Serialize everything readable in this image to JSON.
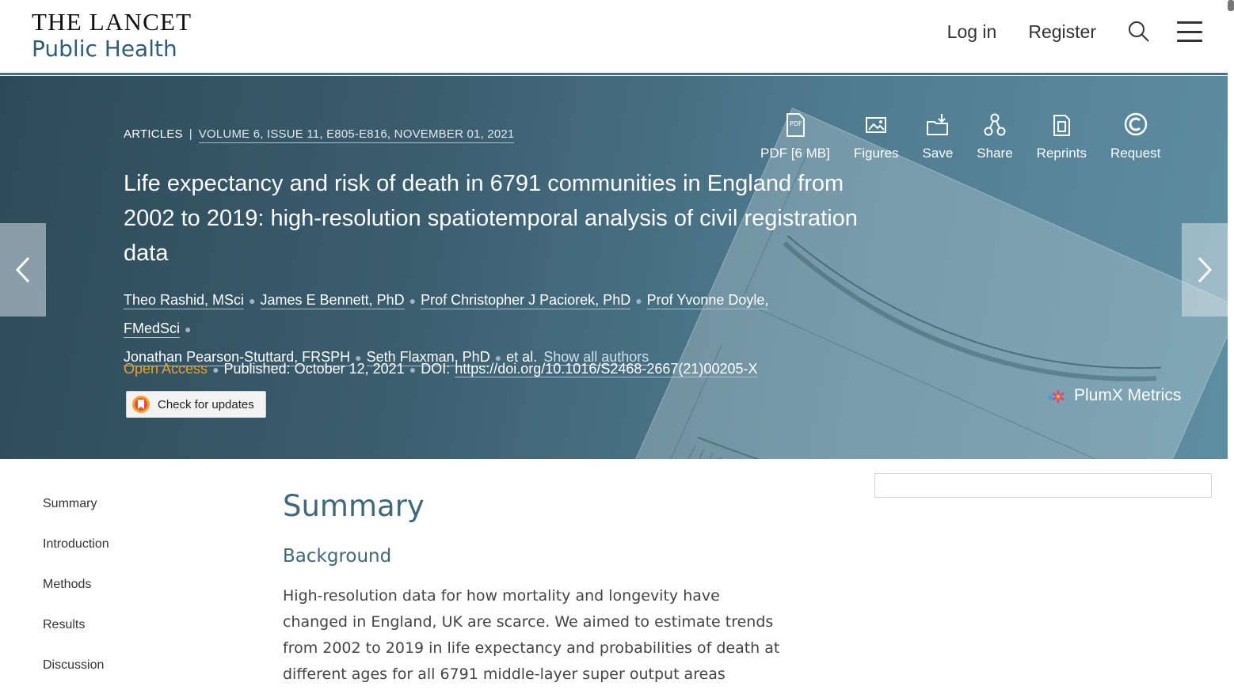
{
  "header": {
    "logo_line1": "THE LANCET",
    "logo_line2": "Public Health",
    "login": "Log in",
    "register": "Register",
    "search_icon": "search-icon",
    "menu_icon": "hamburger-menu-icon"
  },
  "article": {
    "type": "ARTICLES",
    "volume": "VOLUME 6, ISSUE 11, E805-E816, NOVEMBER 01, 2021",
    "title": "Life expectancy and risk of death in 6791 communities in England from 2002 to 2019: high-resolution spatiotemporal analysis of civil registration data",
    "authors": [
      "Theo Rashid, MSci",
      "James E Bennett, PhD",
      "Prof Christopher J Paciorek, PhD",
      "Prof Yvonne Doyle, FMedSci",
      "Jonathan Pearson-Stuttard, FRSPH",
      "Seth Flaxman, PhD"
    ],
    "et_al": "et al.",
    "show_all_authors": "Show all authors",
    "open_access": "Open Access",
    "published_label": "Published:",
    "published_date": "October 12, 2021",
    "doi_label": "DOI:",
    "doi": "https://doi.org/10.1016/S2468-2667(21)00205-X",
    "check_updates": "Check for updates",
    "plumx": "PlumX Metrics"
  },
  "tools": [
    {
      "label": "PDF [6 MB]",
      "icon": "pdf-icon"
    },
    {
      "label": "Figures",
      "icon": "image-icon"
    },
    {
      "label": "Save",
      "icon": "folder-save-icon"
    },
    {
      "label": "Share",
      "icon": "share-icon"
    },
    {
      "label": "Reprints",
      "icon": "reprints-icon"
    },
    {
      "label": "Request",
      "icon": "copyright-icon"
    }
  ],
  "toc": [
    "Summary",
    "Introduction",
    "Methods",
    "Results",
    "Discussion"
  ],
  "content": {
    "heading": "Summary",
    "subheading": "Background",
    "paragraph": "High-resolution data for how mortality and longevity have changed in England, UK are scarce. We aimed to estimate trends from 2002 to 2019 in life expectancy and probabilities of death at different ages for all 6791 middle-layer super output areas (MSOAs) in England."
  },
  "colors": {
    "accent": "#3f6878",
    "open_access": "#f39c1f",
    "hero_dark": "#2d4a58",
    "hero_light": "#5e8ea2"
  }
}
